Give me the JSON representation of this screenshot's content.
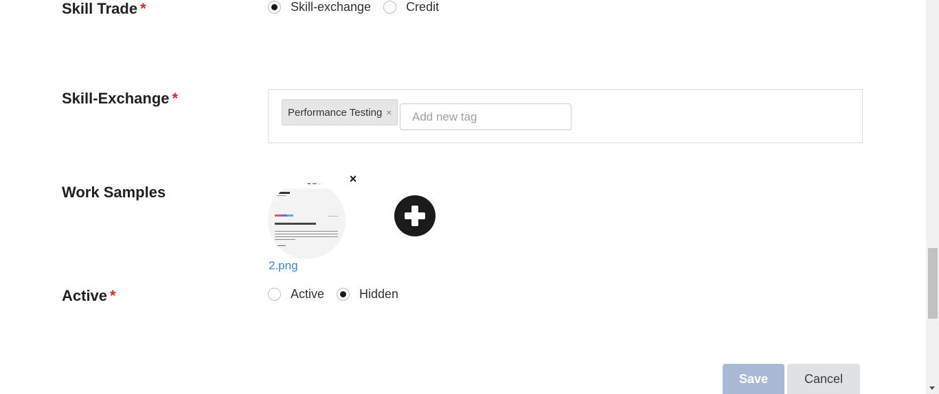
{
  "skill_trade": {
    "label": "Skill Trade",
    "required_mark": "*",
    "options": [
      {
        "label": "Skill-exchange",
        "checked": true
      },
      {
        "label": "Credit",
        "checked": false
      }
    ]
  },
  "skill_exchange": {
    "label": "Skill-Exchange",
    "required_mark": "*",
    "tags": [
      {
        "label": "Performance Testing",
        "remove": "×"
      }
    ],
    "input_placeholder": "Add new tag"
  },
  "work_samples": {
    "label": "Work Samples",
    "remove_icon": "×",
    "file_name": "2.png",
    "add_icon": "plus-circle-icon"
  },
  "active": {
    "label": "Active",
    "required_mark": "*",
    "options": [
      {
        "label": "Active",
        "checked": false
      },
      {
        "label": "Hidden",
        "checked": true
      }
    ]
  },
  "actions": {
    "save_label": "Save",
    "cancel_label": "Cancel",
    "save_color": "#a8b9d6",
    "cancel_color": "#e0e1e2"
  },
  "colors": {
    "required": "#db2828",
    "link": "#4183c4"
  }
}
